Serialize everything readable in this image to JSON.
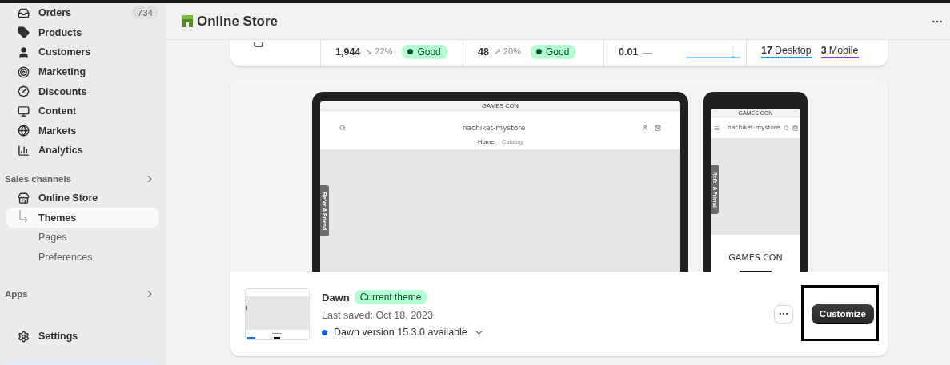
{
  "sidebar": {
    "items": [
      {
        "label": "Orders",
        "badge": "734"
      },
      {
        "label": "Products"
      },
      {
        "label": "Customers"
      },
      {
        "label": "Marketing"
      },
      {
        "label": "Discounts"
      },
      {
        "label": "Content"
      },
      {
        "label": "Markets"
      },
      {
        "label": "Analytics"
      }
    ],
    "sales_channels": {
      "title": "Sales channels",
      "store": "Online Store",
      "sub_items": [
        {
          "label": "Themes",
          "selected": true
        },
        {
          "label": "Pages",
          "selected": false
        },
        {
          "label": "Preferences",
          "selected": false
        }
      ]
    },
    "apps": {
      "title": "Apps"
    },
    "settings": {
      "label": "Settings"
    }
  },
  "header": {
    "title": "Online Store"
  },
  "metrics": [
    {
      "kind": "empty"
    },
    {
      "kind": "score",
      "value": "1,944",
      "trend_icon": "↘",
      "change": "22%",
      "status": "Good"
    },
    {
      "kind": "score",
      "value": "48",
      "trend_icon": "↗",
      "change": "20%",
      "status": "Good"
    },
    {
      "kind": "sparkline",
      "value": "0.01",
      "change": "—"
    },
    {
      "kind": "devices",
      "devices": [
        {
          "count": "17",
          "label": "Desktop",
          "color": "#1f9bde"
        },
        {
          "count": "3",
          "label": "Mobile",
          "color": "#7b3fe4"
        }
      ]
    }
  ],
  "preview": {
    "desktop": {
      "announcement": "GAMES CON",
      "store_name": "nachiket-mystore",
      "nav": [
        {
          "label": "Home",
          "selected": true
        },
        {
          "label": "Catalog",
          "selected": false
        }
      ],
      "side_tab": "Refer A Friend"
    },
    "mobile": {
      "announcement": "GAMES CON",
      "store_name": "nachiket-mystore",
      "side_tab": "Refer A Friend",
      "heading": "GAMES CON"
    }
  },
  "theme": {
    "name": "Dawn",
    "badge": "Current theme",
    "last_saved": "Last saved: Oct 18, 2023",
    "update": "Dawn version 15.3.0 available",
    "customize": {
      "label": "Customize",
      "highlighted": true
    }
  }
}
